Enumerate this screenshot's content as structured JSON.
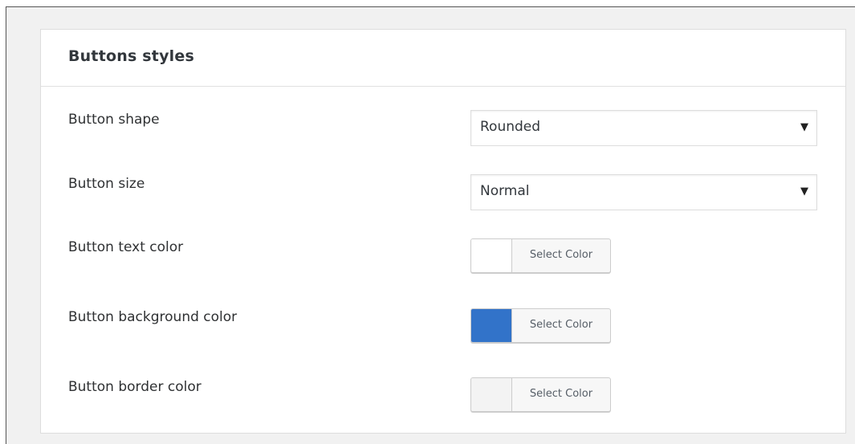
{
  "panel": {
    "title": "Buttons styles"
  },
  "settings": {
    "button_shape": {
      "label": "Button shape",
      "value": "Rounded"
    },
    "button_size": {
      "label": "Button size",
      "value": "Normal"
    },
    "button_text_color": {
      "label": "Button text color",
      "button_label": "Select Color",
      "swatch_color": "#ffffff"
    },
    "button_background_color": {
      "label": "Button background color",
      "button_label": "Select Color",
      "swatch_color": "#3273c9"
    },
    "button_border_color": {
      "label": "Button border color",
      "button_label": "Select Color",
      "swatch_color": "#f3f3f3"
    }
  },
  "icons": {
    "dropdown_arrow": "▼"
  }
}
